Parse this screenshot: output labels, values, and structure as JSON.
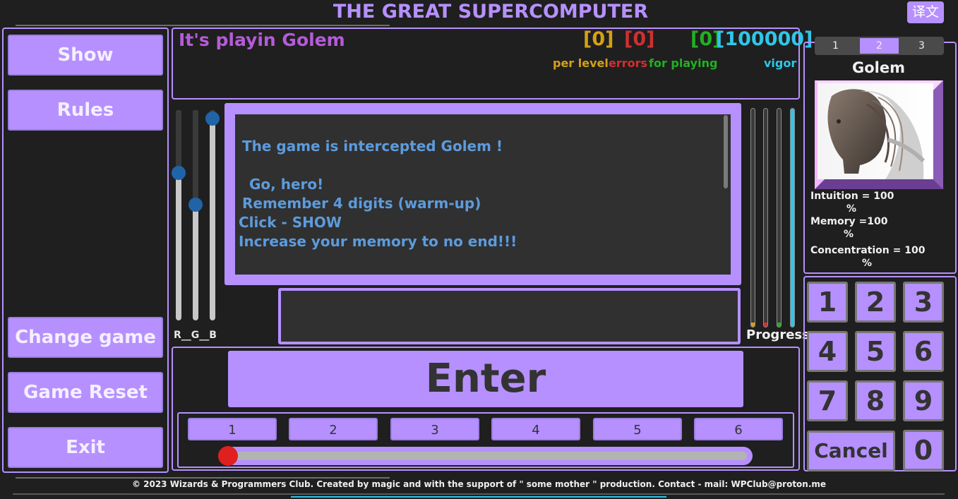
{
  "title": "THE GREAT SUPERCOMPUTER",
  "translate_label": "译文",
  "sidebar": {
    "show": "Show",
    "rules": "Rules",
    "change_game": "Change game",
    "game_reset": "Game Reset",
    "exit": "Exit"
  },
  "info": {
    "playing_text": "It's playin Golem",
    "per_level_value": "[0]",
    "errors_value": "[0]",
    "for_playing_value": "[0]",
    "vigor_value": "[100000]",
    "per_level_label": "per level",
    "errors_label": "errors",
    "for_playing_label": "for playing",
    "vigor_label": "vigor"
  },
  "colors": {
    "accent": "#b690ff",
    "per_level": "#d4a017",
    "errors": "#d03030",
    "for_playing": "#22b022",
    "vigor": "#2fc6e8"
  },
  "rgb": {
    "label": "R__G__B",
    "levels": [
      0.7,
      0.55,
      0.96
    ]
  },
  "message": {
    "lines": [
      "The game is intercepted Golem !",
      "Go, hero!",
      "Remember   4 digits (warm-up)",
      "Click - SHOW",
      "Increase your memory to no end!!!"
    ]
  },
  "progress": {
    "label": "Progress",
    "bars": [
      {
        "color": "#d4a017",
        "level": 0.02
      },
      {
        "color": "#d03030",
        "level": 0.02
      },
      {
        "color": "#22b022",
        "level": 0.02
      },
      {
        "color": "#2fc6e8",
        "level": 1.0
      }
    ]
  },
  "enter_label": "Enter",
  "levels": [
    "1",
    "2",
    "3",
    "4",
    "5",
    "6"
  ],
  "level_slider_value": 0,
  "character": {
    "tabs": [
      "1",
      "2",
      "3"
    ],
    "active_tab": "2",
    "name": "Golem",
    "intuition": "Intuition = 100",
    "memory": "Memory =100",
    "concentration": "Concentration = 100",
    "percent": "%"
  },
  "keypad": {
    "keys": [
      "1",
      "2",
      "3",
      "4",
      "5",
      "6",
      "7",
      "8",
      "9"
    ],
    "zero": "0",
    "cancel": "Cancel"
  },
  "footer": "© 2023 Wizards & Programmers Club. Created by magic and with the support of \" some mother \" production. Contact - mail: WPClub@proton.me"
}
